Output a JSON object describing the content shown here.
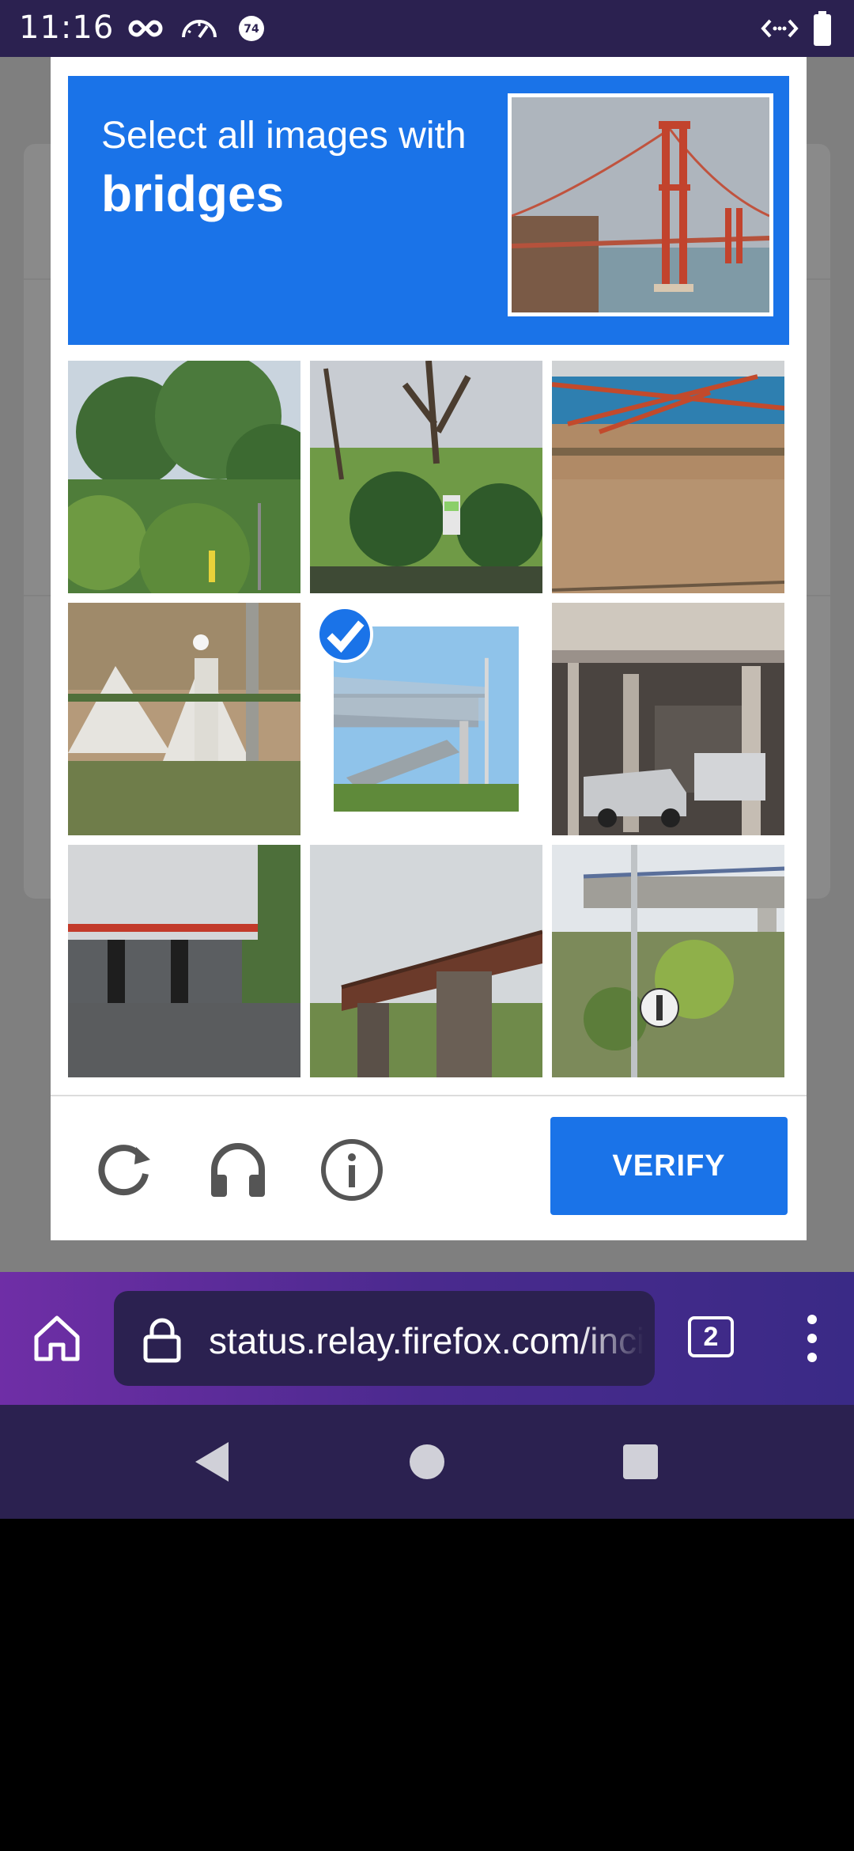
{
  "status_bar": {
    "time": "11:16",
    "notification_badge": "74",
    "icons": [
      "infinity-icon",
      "speedometer-icon",
      "badge-74-icon",
      "code-arrows-icon",
      "battery-icon"
    ]
  },
  "captcha": {
    "prompt_prefix": "Select all images with",
    "prompt_target": "bridges",
    "example_image": "golden-gate-bridge",
    "tiles": [
      {
        "label": "trees-hillside",
        "selected": false
      },
      {
        "label": "park-trees",
        "selected": false
      },
      {
        "label": "construction-yard",
        "selected": false
      },
      {
        "label": "concrete-barrier",
        "selected": false
      },
      {
        "label": "pedestrian-bridge",
        "selected": true
      },
      {
        "label": "parking-garage",
        "selected": false
      },
      {
        "label": "truck-trailer",
        "selected": false
      },
      {
        "label": "railway-bridge",
        "selected": false
      },
      {
        "label": "highway-overpass",
        "selected": false
      }
    ],
    "tools": [
      "refresh-icon",
      "headphones-icon",
      "info-icon"
    ],
    "verify_label": "VERIFY"
  },
  "browser": {
    "url": "status.relay.firefox.com/incidents",
    "tab_count": "2"
  },
  "colors": {
    "accent": "#1a73e8",
    "status_bar": "#2b2150",
    "toolbar_start": "#6f2ea6",
    "toolbar_end": "#3a2a86"
  }
}
